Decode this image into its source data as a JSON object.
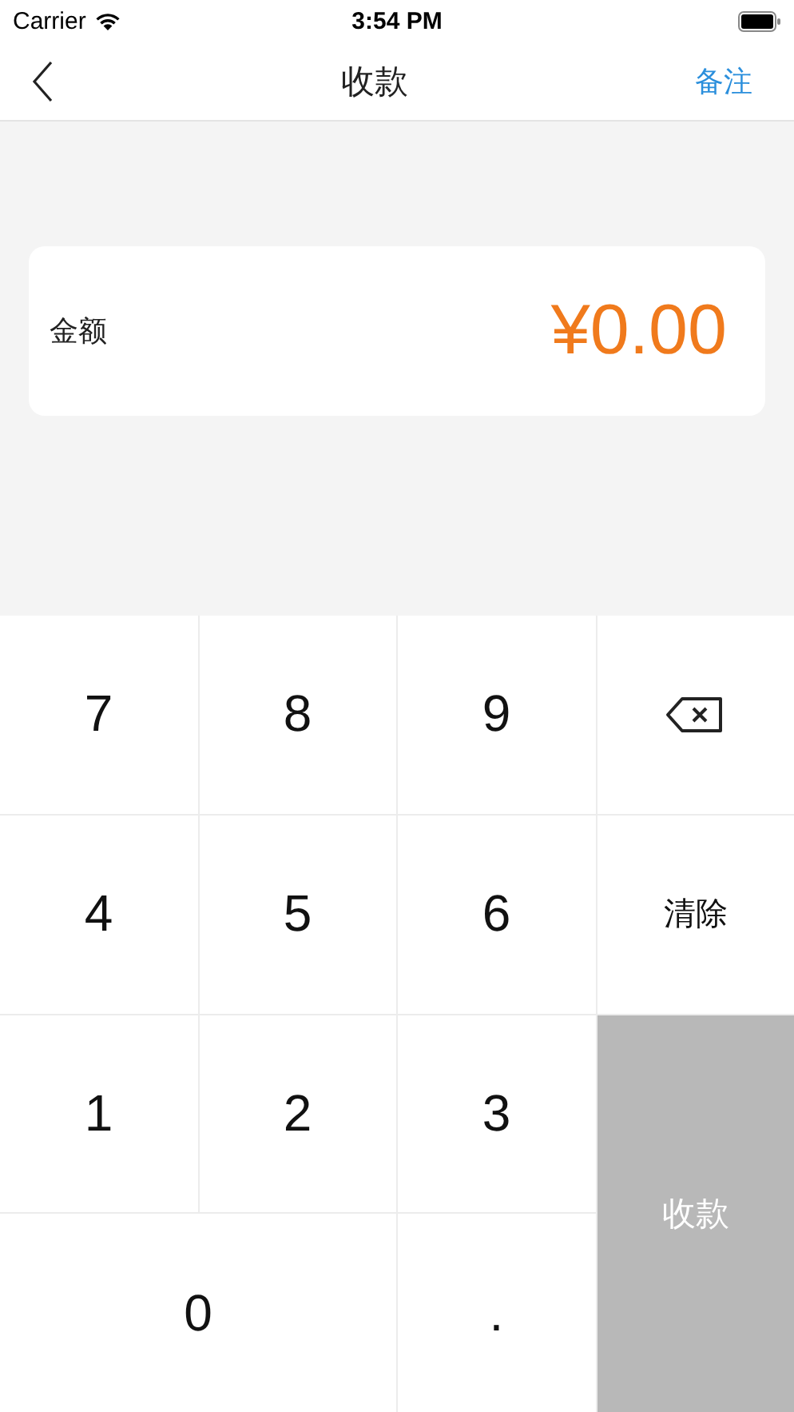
{
  "status_bar": {
    "carrier": "Carrier",
    "time": "3:54 PM"
  },
  "nav": {
    "title": "收款",
    "action": "备注"
  },
  "amount": {
    "label": "金额",
    "value": "¥0.00"
  },
  "keys": [
    {
      "kind": "digit",
      "label": "7"
    },
    {
      "kind": "digit",
      "label": "8"
    },
    {
      "kind": "digit",
      "label": "9"
    },
    {
      "kind": "backspace"
    },
    {
      "kind": "digit",
      "label": "4"
    },
    {
      "kind": "digit",
      "label": "5"
    },
    {
      "kind": "digit",
      "label": "6"
    },
    {
      "kind": "clear",
      "label": "清除"
    },
    {
      "kind": "digit",
      "label": "1"
    },
    {
      "kind": "digit",
      "label": "2"
    },
    {
      "kind": "digit",
      "label": "3"
    },
    {
      "kind": "submit",
      "label": "收款",
      "disabled": true
    },
    {
      "kind": "digit",
      "label": "0",
      "wide": true
    },
    {
      "kind": "digit",
      "label": "."
    }
  ]
}
